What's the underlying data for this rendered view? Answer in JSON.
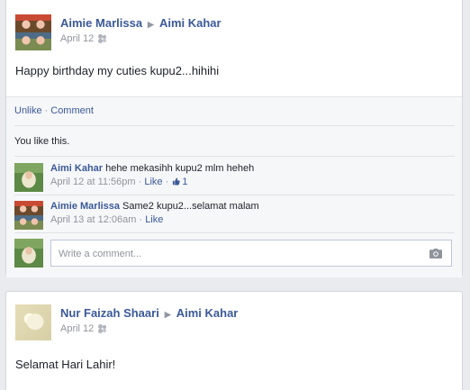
{
  "stories": [
    {
      "author": "Aimie Marlissa",
      "target": "Aimi Kahar",
      "date": "April 12",
      "text": "Happy birthday my cuties kupu2...hihihi",
      "actions": {
        "unlike": "Unlike",
        "sep": "·",
        "comment": "Comment"
      },
      "likes_text": "You like this.",
      "comments": [
        {
          "author": "Aimi Kahar",
          "text": "hehe mekasihh kupu2 mlm heheh",
          "time": "April 12 at 11:56pm",
          "sep": "·",
          "like_label": "Like",
          "like_count": "1"
        },
        {
          "author": "Aimie Marlissa",
          "text": "Same2 kupu2...selamat malam",
          "time": "April 13 at 12:06am",
          "sep": "·",
          "like_label": "Like"
        }
      ],
      "comment_placeholder": "Write a comment..."
    },
    {
      "author": "Nur Faizah Shaari",
      "target": "Aimi Kahar",
      "date": "April 12",
      "text": "Selamat Hari Lahir!"
    }
  ],
  "icons": {
    "arrow": "▶",
    "audience": "friends-icon",
    "like": "thumbs-up-icon",
    "photo": "camera-icon"
  },
  "colors": {
    "link": "#3b5998",
    "muted": "#90949c",
    "background": "#e9ebee"
  }
}
